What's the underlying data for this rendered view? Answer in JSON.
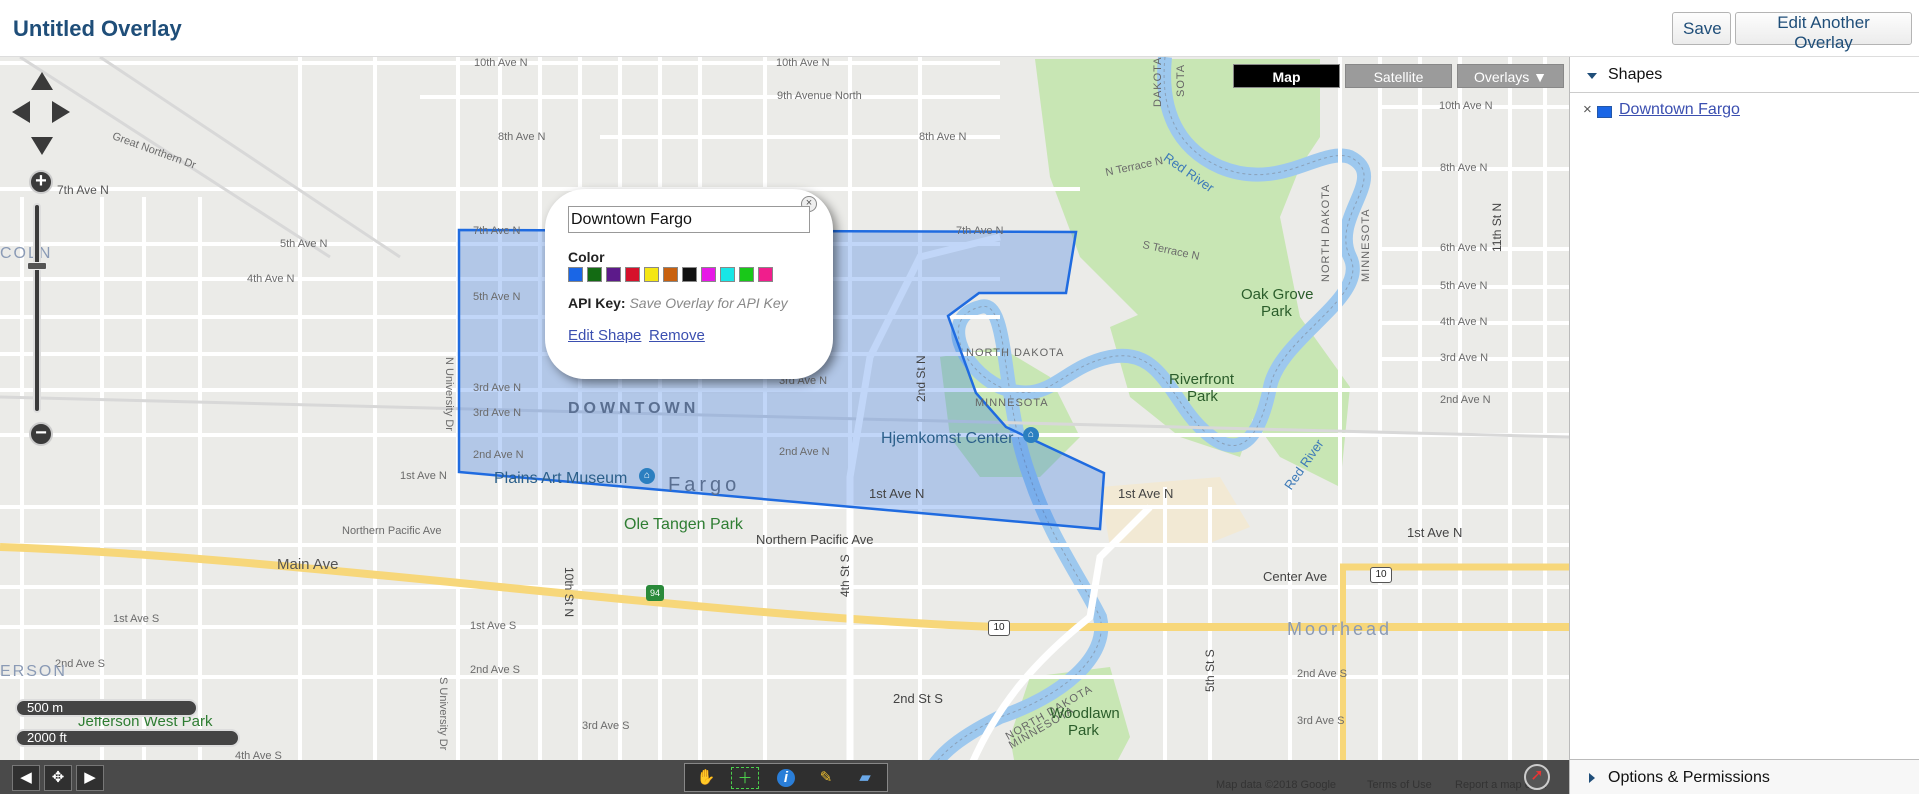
{
  "header": {
    "title": "Untitled Overlay",
    "save_label": "Save",
    "edit_another_label": "Edit Another Overlay"
  },
  "map_types": {
    "map": "Map",
    "satellite": "Satellite",
    "overlays": "Overlays ▼",
    "active": "Map"
  },
  "streets": {
    "ave_10th": "10th Ave N",
    "ave_9th": "9th Avenue North",
    "ave_8th": "8th Ave N",
    "ave_8th_right": "8th Ave N",
    "ave_7th": "7th Ave N",
    "ave_7th_b": "7th Ave N",
    "ave_6th": "6th Ave N",
    "ave_5th": "5th Ave N",
    "ave_5th_b": "5th Ave N",
    "ave_5th_right": "5th Ave N",
    "ave_4th": "4th Ave N",
    "ave_4th_right": "4th Ave N",
    "ave_3rd": "3rd Ave N",
    "ave_3rd_right": "3rd Ave N",
    "ave_3rd_b": "3rd Ave N",
    "ave_2nd": "2nd Ave N",
    "ave_2nd_b": "2nd Ave N",
    "ave_2nd_right": "2nd Ave N",
    "ave_1st": "1st Ave N",
    "ave_1st_center": "1st Ave N",
    "ave_1st_east": "1st Ave N",
    "ave_1st_e2": "1st Ave N",
    "great_northern": "Great Northern Dr",
    "northern_pacific": "Northern Pacific Ave",
    "northern_pacific_w": "Northern Pacific Ave",
    "main_ave": "Main Ave",
    "center_ave": "Center Ave",
    "first_ave_s": "1st Ave S",
    "first_ave_s2": "1st Ave S",
    "second_ave_s": "2nd Ave S",
    "second_ave_s2": "2nd Ave S",
    "second_ave_s3": "2nd Ave S",
    "second_st_s": "2nd St S",
    "third_ave_s": "3rd Ave S",
    "third_ave_s2": "3rd Ave S",
    "fourth_ave_s": "4th Ave S",
    "n_terrace": "N Terrace N",
    "s_terrace": "S Terrace N",
    "univ_dr_n": "N University Dr",
    "univ_dr_s": "S University Dr",
    "tenth_st_n": "10th St N",
    "fourth_st_s": "4th St S",
    "second_st_n": "2nd St N",
    "fifth_st_s": "5th St S",
    "eleventh_st_n": "11th St N",
    "red_river": "Red River",
    "red_river_2": "Red River",
    "nd": "NORTH DAKOTA",
    "nd2": "NORTH DAKOTA",
    "mn": "MINNESOTA",
    "mn2": "MINNESOTA",
    "mn3": "MINNESOTA",
    "dakota_top": "DAKOTA",
    "sota_top": "SOTA",
    "coln": "COLN",
    "erson": "ERSON",
    "moorhead": "Moorhead",
    "fargo": "Fargo",
    "downtown": "DOWNTOWN",
    "hwy_94": "94",
    "hwy_10": "10",
    "hwy_10b": "10"
  },
  "pois": {
    "plains_art": "Plains Art Museum",
    "ole_tangen": "Ole Tangen Park",
    "hjemkomst": "Hjemkomst Center",
    "oak_grove_1": "Oak Grove",
    "oak_grove_2": "Park",
    "riverfront_1": "Riverfront",
    "riverfront_2": "Park",
    "woodlawn_1": "Woodlawn",
    "woodlawn_2": "Park",
    "jefferson": "Jefferson West Park"
  },
  "scale": {
    "metric": "500 m",
    "imperial": "2000 ft"
  },
  "popup": {
    "name_value": "Downtown Fargo",
    "color_label": "Color",
    "colors": [
      "#1a66e6",
      "#136b13",
      "#5c1a8a",
      "#d6112b",
      "#f5e614",
      "#c8610f",
      "#111111",
      "#e619e6",
      "#19e6e6",
      "#19c819",
      "#f01e8c"
    ],
    "api_key_label": "API Key:",
    "api_key_hint": "Save Overlay for API Key",
    "edit_shape": "Edit Shape",
    "remove": "Remove",
    "close_glyph": "×"
  },
  "shape": {
    "fill_color": "#1a66e6",
    "stroke_color": "#1f6be0"
  },
  "toolbar": {
    "prev": "◀",
    "fit": "✥",
    "next": "▶",
    "hand": "✋",
    "add": "＋",
    "info": "i",
    "draw": "✎",
    "folder": "▰"
  },
  "attribution": {
    "data": "Map data ©2018 Google",
    "terms": "Terms of Use",
    "report": "Report a map error"
  },
  "panel": {
    "shapes_title": "Shapes",
    "shape_name": "Downtown Fargo",
    "remove_glyph": "×",
    "options_title": "Options & Permissions"
  }
}
